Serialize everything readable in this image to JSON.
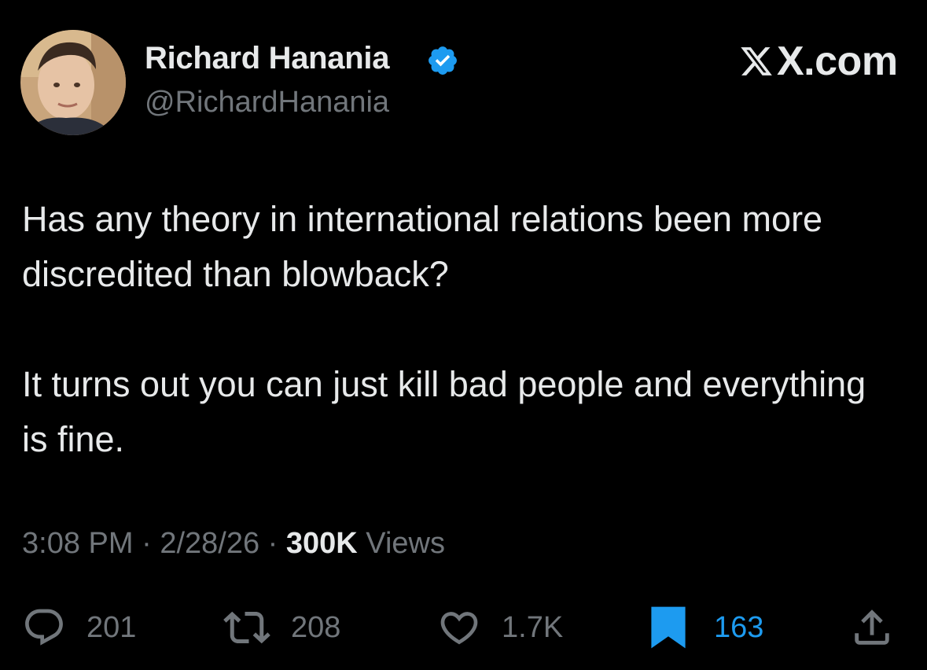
{
  "author": {
    "display_name": "Richard Hanania",
    "handle": "@RichardHanania",
    "verified": true
  },
  "site": {
    "domain": "X.com"
  },
  "tweet": {
    "paragraphs": [
      "Has any theory in international relations been more discredited than blowback?",
      "It turns out you can just kill bad people and everything is fine."
    ],
    "time": "3:08 PM",
    "date": "2/28/26",
    "separator": "·",
    "views_count": "300K",
    "views_label": "Views"
  },
  "actions": {
    "replies": "201",
    "reposts": "208",
    "likes": "1.7K",
    "bookmarks": "163"
  },
  "colors": {
    "background": "#000000",
    "primary_text": "#e7e9ea",
    "secondary_text": "#71767b",
    "accent_blue": "#1d9bf0"
  },
  "icons": {
    "verified": "verified-badge-icon",
    "logo": "x-logo-icon",
    "reply": "speech-bubble-icon",
    "repost": "repost-arrows-icon",
    "like": "heart-icon",
    "bookmark": "bookmark-icon",
    "share": "share-upload-icon"
  }
}
